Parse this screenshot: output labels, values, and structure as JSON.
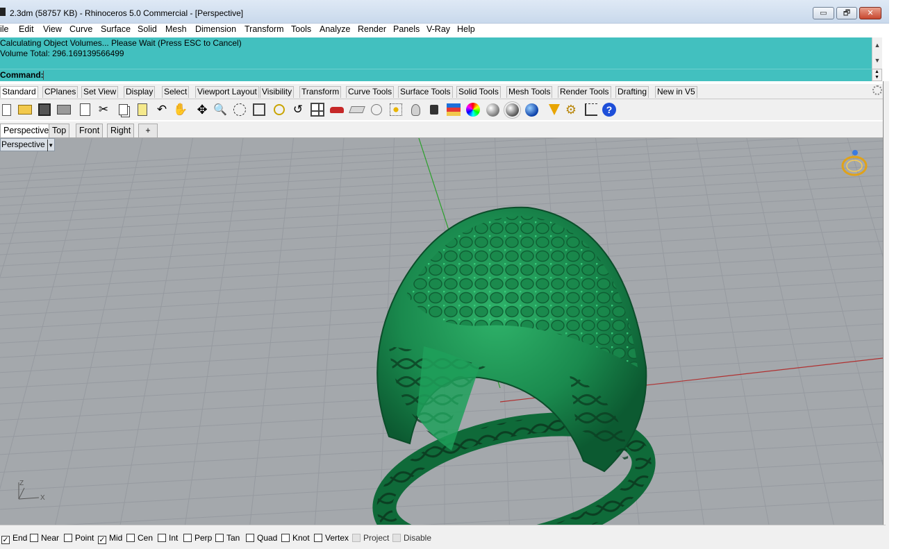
{
  "window": {
    "title": "2.3dm (58757 KB) - Rhinoceros 5.0 Commercial - [Perspective]",
    "minimize_glyph": "▭",
    "restore_glyph": "🗗",
    "close_glyph": "✕"
  },
  "menu": [
    "ile",
    "Edit",
    "View",
    "Curve",
    "Surface",
    "Solid",
    "Mesh",
    "Dimension",
    "Transform",
    "Tools",
    "Analyze",
    "Render",
    "Panels",
    "V-Ray",
    "Help"
  ],
  "command_history": {
    "line1": "Calculating Object Volumes... Please Wait (Press ESC to Cancel)",
    "line2": "Volume Total: 296.169139566499",
    "scroll_up": "▲",
    "scroll_down": "▼"
  },
  "command_line": {
    "prompt": "Command:",
    "value": ""
  },
  "toolbar_tabs": [
    "Standard",
    "CPlanes",
    "Set View",
    "Display",
    "Select",
    "Viewport Layout",
    "Visibility",
    "Transform",
    "Curve Tools",
    "Surface Tools",
    "Solid Tools",
    "Mesh Tools",
    "Render Tools",
    "Drafting",
    "New in V5"
  ],
  "toolbar_icons": [
    "new-file",
    "open-file",
    "save",
    "print",
    "import",
    "cut",
    "copy",
    "paste",
    "undo",
    "pan",
    "rotate-view",
    "zoom-dynamic",
    "zoom-window",
    "zoom-extents",
    "zoom-selected",
    "undo-view",
    "four-viewports",
    "car",
    "hide",
    "show-points",
    "select-filter",
    "light-bulb",
    "lock",
    "layer",
    "color-wheel",
    "shaded",
    "rendered",
    "render-sphere",
    "filter",
    "options-gear",
    "grid-snap",
    "help"
  ],
  "viewport_tabs": [
    "Perspective",
    "Top",
    "Front",
    "Right"
  ],
  "viewport_add_tab": "+",
  "viewport": {
    "label": "Perspective",
    "dropdown": "▼",
    "axis_labels": {
      "z": "Z",
      "x": "X"
    },
    "background": "#a4a8ac",
    "grid_color": "#9599a0",
    "object_color": "#1a8a4e"
  },
  "osnaps": [
    {
      "label": "End",
      "checked": true
    },
    {
      "label": "Near",
      "checked": false
    },
    {
      "label": "Point",
      "checked": false
    },
    {
      "label": "Mid",
      "checked": true
    },
    {
      "label": "Cen",
      "checked": false
    },
    {
      "label": "Int",
      "checked": false
    },
    {
      "label": "Perp",
      "checked": false
    },
    {
      "label": "Tan",
      "checked": false
    },
    {
      "label": "Quad",
      "checked": false
    },
    {
      "label": "Knot",
      "checked": false
    },
    {
      "label": "Vertex",
      "checked": false
    },
    {
      "label": "Project",
      "checked": false,
      "disabled": true
    },
    {
      "label": "Disable",
      "checked": false,
      "disabled": true
    }
  ]
}
